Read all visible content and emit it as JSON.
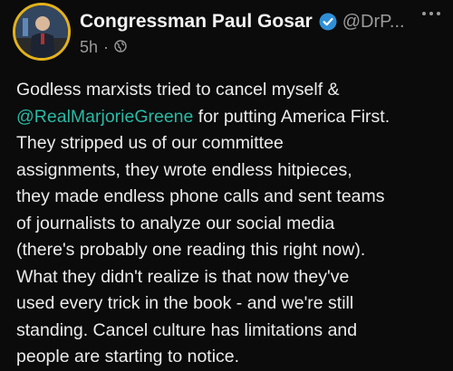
{
  "author": {
    "display_name": "Congressman Paul Gosar",
    "handle": "@DrP...",
    "timestamp": "5h",
    "separator": "·",
    "verified_icon": "verified-badge-icon",
    "visibility_icon": "public-globe-icon"
  },
  "tweet": {
    "line_1": "Godless marxists tried to cancel myself &",
    "mention": "@RealMarjorieGreene",
    "line_2_rest": " for putting America First.",
    "line_3": "They stripped us of our committee",
    "line_4": "assignments, they wrote endless hitpieces,",
    "line_5": "they made endless phone calls and sent teams",
    "line_6": "of journalists to analyze our social media",
    "line_7": "(there's probably one reading this right now).",
    "line_8": "What they didn't realize is that now they've",
    "line_9": "used every trick in the book - and we're still",
    "line_10": "standing. Cancel culture has limitations and",
    "line_11": "people are starting to notice."
  },
  "colors": {
    "background": "#0b0b0b",
    "mention": "#29b9a5",
    "verified": "#2f8fd6",
    "avatar_ring": "#e3b21b"
  }
}
